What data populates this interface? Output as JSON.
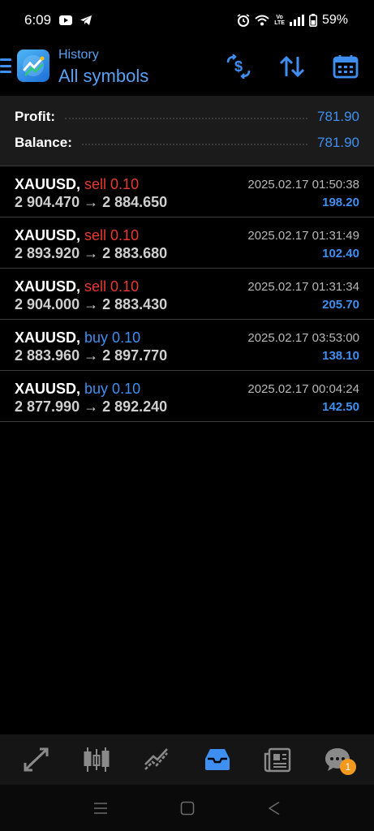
{
  "status": {
    "time": "6:09",
    "battery": "59%",
    "network_label_top": "Vo",
    "network_label_bottom": "LTE"
  },
  "header": {
    "subtitle": "History",
    "title": "All symbols",
    "icons": [
      "menu-icon",
      "app-logo",
      "currency-icon",
      "sort-icon",
      "calendar-icon"
    ]
  },
  "summary": {
    "profit_label": "Profit:",
    "profit_value": "781.90",
    "balance_label": "Balance:",
    "balance_value": "781.90"
  },
  "deals": [
    {
      "symbol": "XAUUSD,",
      "type": "sell 0.10",
      "side": "sell",
      "prices": "2 904.470 → 2 884.650",
      "time": "2025.02.17 01:50:38",
      "profit": "198.20"
    },
    {
      "symbol": "XAUUSD,",
      "type": "sell 0.10",
      "side": "sell",
      "prices": "2 893.920 → 2 883.680",
      "time": "2025.02.17 01:31:49",
      "profit": "102.40"
    },
    {
      "symbol": "XAUUSD,",
      "type": "sell 0.10",
      "side": "sell",
      "prices": "2 904.000 → 2 883.430",
      "time": "2025.02.17 01:31:34",
      "profit": "205.70"
    },
    {
      "symbol": "XAUUSD,",
      "type": "buy 0.10",
      "side": "buy",
      "prices": "2 883.960 → 2 897.770",
      "time": "2025.02.17 03:53:00",
      "profit": "138.10"
    },
    {
      "symbol": "XAUUSD,",
      "type": "buy 0.10",
      "side": "buy",
      "prices": "2 877.990 → 2 892.240",
      "time": "2025.02.17 00:04:24",
      "profit": "142.50"
    }
  ],
  "tabs": {
    "items": [
      "quotes-icon",
      "chart-icon",
      "trade-icon",
      "history-icon",
      "news-icon",
      "chat-icon"
    ],
    "active": "history-icon",
    "chat_badge": "1"
  },
  "colors": {
    "accent": "#3f8ff0",
    "sell": "#e8382f",
    "badge": "#f39a1e"
  }
}
